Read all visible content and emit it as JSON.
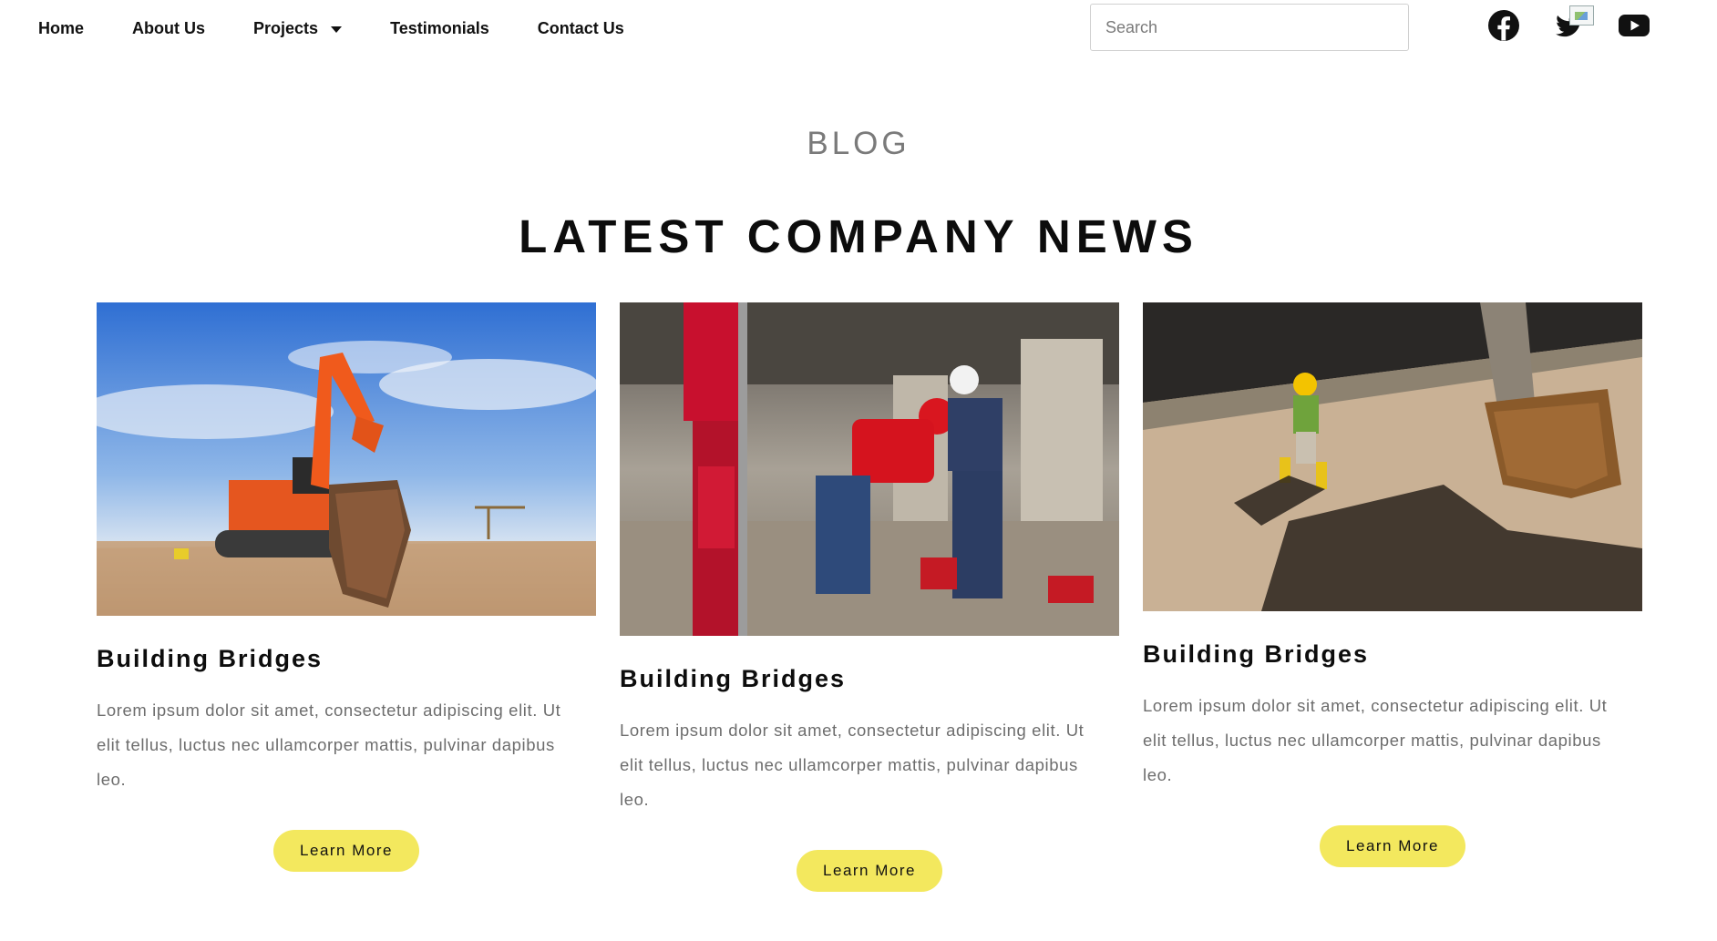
{
  "nav": {
    "items": [
      {
        "label": "Home"
      },
      {
        "label": "About Us"
      },
      {
        "label": "Projects",
        "has_dropdown": true
      },
      {
        "label": "Testimonials"
      },
      {
        "label": "Contact Us"
      }
    ],
    "search_placeholder": "Search",
    "social": [
      "facebook-icon",
      "twitter-icon",
      "youtube-icon"
    ]
  },
  "section": {
    "eyebrow": "BLOG",
    "title": "LATEST COMPANY NEWS"
  },
  "cards": [
    {
      "image": "excavator-sky-photo",
      "title": "Building Bridges",
      "text": "Lorem ipsum dolor sit amet, consectetur adipiscing elit. Ut elit tellus, luctus nec ullamcorper mattis, pulvinar dapibus leo.",
      "button": "Learn More"
    },
    {
      "image": "workers-drilling-photo",
      "title": "Building Bridges",
      "text": "Lorem ipsum dolor sit amet, consectetur adipiscing elit. Ut elit tellus, luctus nec ullamcorper mattis, pulvinar dapibus leo.",
      "button": "Learn More"
    },
    {
      "image": "worker-walking-site-photo",
      "title": "Building Bridges",
      "text": "Lorem ipsum dolor sit amet, consectetur adipiscing elit. Ut elit tellus, luctus nec ullamcorper mattis, pulvinar dapibus leo.",
      "button": "Learn More"
    }
  ],
  "colors": {
    "button": "#f3e85e",
    "eyebrow": "#7a7a7a",
    "body_text": "#6d6d6d"
  }
}
